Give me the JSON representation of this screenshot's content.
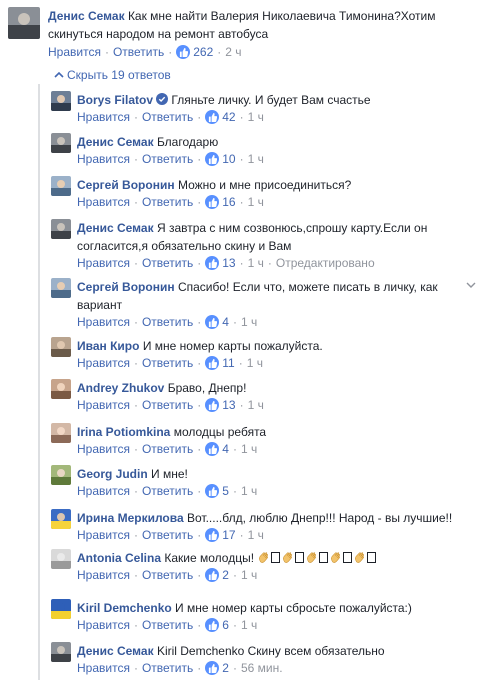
{
  "top_comment": {
    "author": "Денис Семак",
    "text": "Как мне найти Валерия Николаевича Тимонина?Хотим скинуться народом на ремонт автобуса",
    "like_label": "Нравится",
    "reply_label": "Ответить",
    "likes": "262",
    "time": "2 ч"
  },
  "hide_replies_label": "Скрыть 19 ответов",
  "replies": [
    {
      "author": "Borys Filatov",
      "verified": true,
      "text": "Гляньте личку. И будет Вам счастье",
      "likes": "42",
      "time": "1 ч",
      "edited": ""
    },
    {
      "author": "Денис Семак",
      "text": "Благодарю",
      "likes": "10",
      "time": "1 ч",
      "edited": ""
    },
    {
      "author": "Сергей Воронин",
      "text": "Можно и мне присоединиться?",
      "likes": "16",
      "time": "1 ч",
      "edited": ""
    },
    {
      "author": "Денис Семак",
      "text": "Я завтра с ним созвонюсь,спрошу карту.Если он согласится,я обязательно скину и Вам",
      "likes": "13",
      "time": "1 ч",
      "edited": "Отредактировано"
    },
    {
      "author": "Сергей Воронин",
      "text": "Спасибо! Если что, можете писать в личку, как вариант",
      "likes": "4",
      "time": "1 ч",
      "edited": ""
    },
    {
      "author": "Иван Киро",
      "text": "И мне номер карты пожалуйста.",
      "likes": "11",
      "time": "1 ч",
      "edited": ""
    },
    {
      "author": "Andrey Zhukov",
      "text": "Браво, Днепр!",
      "likes": "13",
      "time": "1 ч",
      "edited": ""
    },
    {
      "author": "Irina Potiomkina",
      "text": "молодцы ребята",
      "likes": "4",
      "time": "1 ч",
      "edited": ""
    },
    {
      "author": "Georg Judin",
      "text": "И мне!",
      "likes": "5",
      "time": "1 ч",
      "edited": ""
    },
    {
      "author": "Ирина Меркилова",
      "text": "Вот.....блд, люблю Днепр!!! Народ - вы лучшие!!",
      "likes": "17",
      "time": "1 ч",
      "edited": ""
    },
    {
      "author": "Antonia Celina",
      "text": "Какие молодцы!",
      "likes": "2",
      "time": "1 ч",
      "edited": ""
    },
    {
      "author": "Kiril Demchenko",
      "text": "И мне номер карты сбросьте пожалуйста:)",
      "likes": "6",
      "time": "1 ч",
      "edited": ""
    },
    {
      "author": "Денис Семак",
      "text": "Kiril Demchenko Скину всем обязательно",
      "likes": "2",
      "time": "56 мин.",
      "edited": ""
    }
  ],
  "labels": {
    "like": "Нравится",
    "reply": "Ответить"
  },
  "colors": {
    "link": "#4267b2",
    "name": "#365899",
    "meta": "#90949c",
    "like_badge": "#5890ff"
  },
  "icons": {
    "like": "thumbs-up-icon",
    "verified": "verified-badge-icon",
    "hide": "chevron-up-icon",
    "options": "chevron-down-icon",
    "clap": "clapping-hands-icon"
  }
}
